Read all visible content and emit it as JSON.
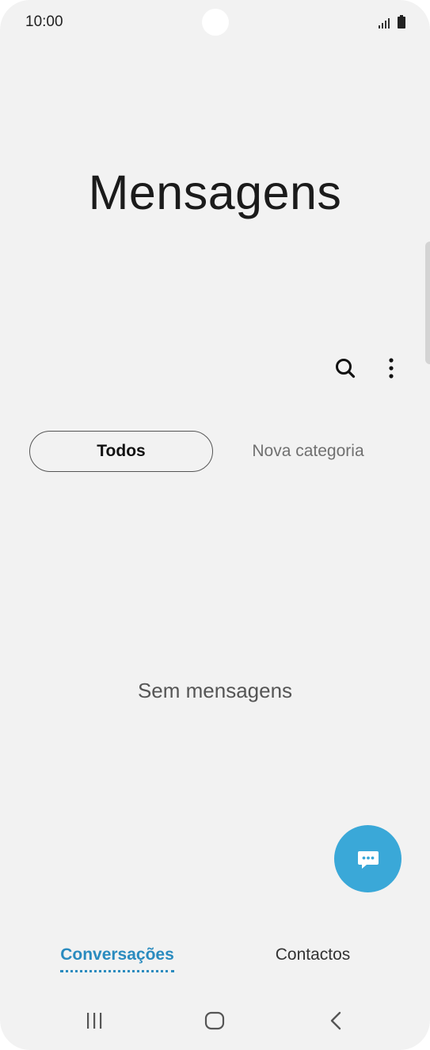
{
  "status_bar": {
    "time": "10:00"
  },
  "header": {
    "title": "Mensagens"
  },
  "toolbar": {
    "search_icon": "search-icon",
    "more_icon": "more-vertical-icon"
  },
  "categories": {
    "tabs": [
      {
        "label": "Todos",
        "selected": true
      },
      {
        "label": "Nova categoria",
        "selected": false
      }
    ]
  },
  "main": {
    "empty_message": "Sem mensagens"
  },
  "fab": {
    "icon": "compose-message-icon",
    "color": "#3aa8d8"
  },
  "bottom_tabs": {
    "items": [
      {
        "label": "Conversações",
        "active": true
      },
      {
        "label": "Contactos",
        "active": false
      }
    ],
    "accent_color": "#2a8bbf"
  },
  "nav_bar": {
    "recent_icon": "recent-apps-icon",
    "home_icon": "home-icon",
    "back_icon": "back-icon"
  }
}
